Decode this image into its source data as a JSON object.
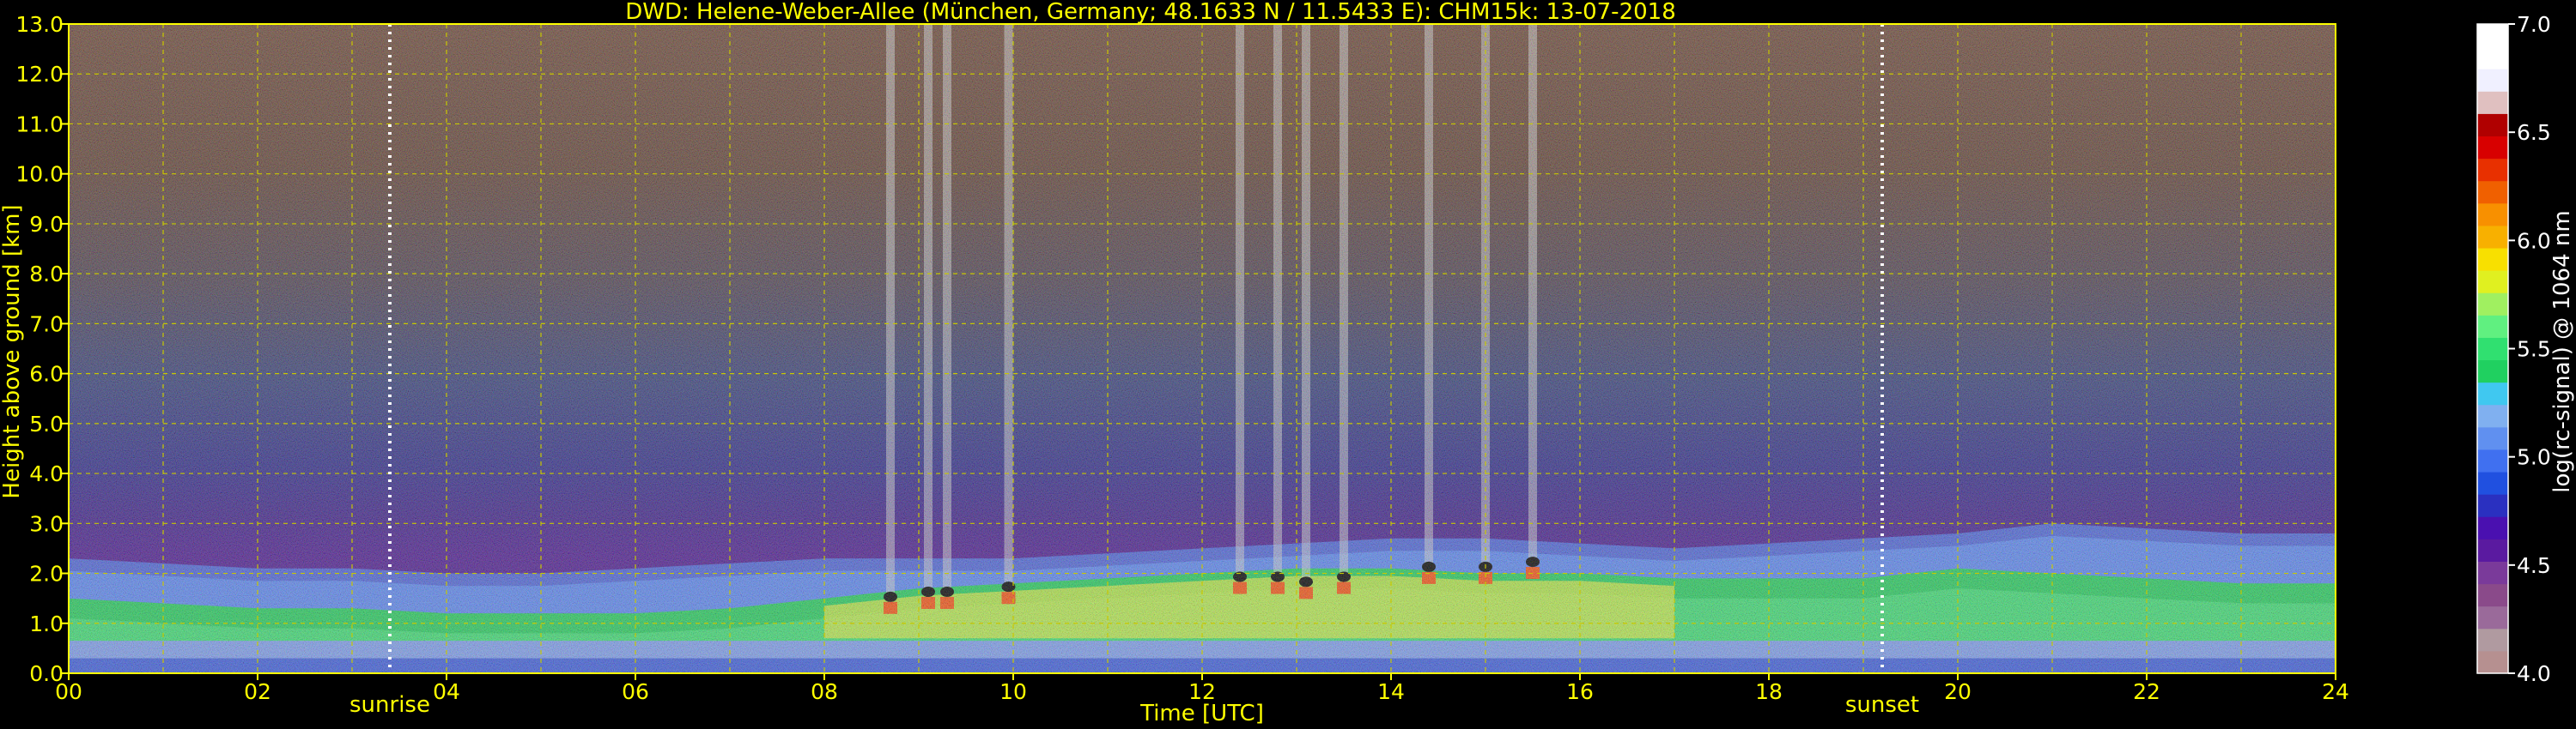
{
  "chart_data": {
    "type": "heatmap",
    "title": "DWD: Helene-Weber-Allee (München, Germany; 48.1633 N / 11.5433 E):    CHM15k: 13-07-2018",
    "xlabel": "Time [UTC]",
    "ylabel": "Height above ground [km]",
    "xlim": [
      0,
      24
    ],
    "ylim": [
      0,
      13
    ],
    "xticks": [
      "00",
      "02",
      "04",
      "06",
      "08",
      "10",
      "12",
      "14",
      "16",
      "18",
      "20",
      "22",
      "24"
    ],
    "yticks": [
      "0.0",
      "1.0",
      "2.0",
      "3.0",
      "4.0",
      "5.0",
      "6.0",
      "7.0",
      "8.0",
      "9.0",
      "10.0",
      "11.0",
      "12.0",
      "13.0"
    ],
    "grid": true,
    "events": [
      {
        "label": "sunrise",
        "time": 3.4
      },
      {
        "label": "sunset",
        "time": 19.2
      }
    ],
    "colorbar": {
      "label": "log(rc-signal) @ 1064 nm",
      "range": [
        4.0,
        7.0
      ],
      "ticks": [
        "4.0",
        "4.5",
        "5.0",
        "5.5",
        "6.0",
        "6.5",
        "7.0"
      ],
      "colors": [
        "#b69090",
        "#b09aa0",
        "#9a6a9a",
        "#8a4a8a",
        "#7a3a9a",
        "#5a1aa0",
        "#4a10b0",
        "#2a30c0",
        "#2050e0",
        "#4070f0",
        "#6090f0",
        "#80b0f0",
        "#40c8f0",
        "#20d060",
        "#30e070",
        "#60f080",
        "#a0f060",
        "#e0f020",
        "#f8e000",
        "#f8b000",
        "#f89000",
        "#f06000",
        "#e83000",
        "#d80000",
        "#b00000",
        "#e0c0c0",
        "#f0f0ff",
        "#ffffff",
        "#ffffff"
      ]
    },
    "boundary_layer_top_km": [
      [
        0,
        2.3
      ],
      [
        1,
        2.2
      ],
      [
        2,
        2.1
      ],
      [
        3,
        2.1
      ],
      [
        4,
        2.0
      ],
      [
        5,
        2.0
      ],
      [
        6,
        2.1
      ],
      [
        7,
        2.2
      ],
      [
        8,
        2.3
      ],
      [
        9,
        2.3
      ],
      [
        10,
        2.3
      ],
      [
        11,
        2.4
      ],
      [
        12,
        2.5
      ],
      [
        13,
        2.6
      ],
      [
        14,
        2.7
      ],
      [
        15,
        2.7
      ],
      [
        16,
        2.6
      ],
      [
        17,
        2.5
      ],
      [
        18,
        2.6
      ],
      [
        19,
        2.7
      ],
      [
        20,
        2.8
      ],
      [
        21,
        3.0
      ],
      [
        22,
        2.9
      ],
      [
        23,
        2.8
      ],
      [
        24,
        2.8
      ]
    ],
    "aerosol_top_km": [
      [
        0,
        1.5
      ],
      [
        1,
        1.4
      ],
      [
        2,
        1.3
      ],
      [
        3,
        1.3
      ],
      [
        4,
        1.2
      ],
      [
        5,
        1.2
      ],
      [
        6,
        1.2
      ],
      [
        7,
        1.3
      ],
      [
        8,
        1.5
      ],
      [
        9,
        1.7
      ],
      [
        10,
        1.8
      ],
      [
        11,
        1.9
      ],
      [
        12,
        2.0
      ],
      [
        13,
        2.1
      ],
      [
        14,
        2.1
      ],
      [
        15,
        2.0
      ],
      [
        16,
        2.0
      ],
      [
        17,
        1.9
      ],
      [
        18,
        1.9
      ],
      [
        19,
        1.9
      ],
      [
        20,
        2.1
      ],
      [
        21,
        2.0
      ],
      [
        22,
        1.9
      ],
      [
        23,
        1.8
      ],
      [
        24,
        1.8
      ]
    ],
    "cloud_events": [
      {
        "time": 8.7,
        "base_km": 1.6
      },
      {
        "time": 9.1,
        "base_km": 1.7
      },
      {
        "time": 9.3,
        "base_km": 1.7
      },
      {
        "time": 9.95,
        "base_km": 1.8
      },
      {
        "time": 12.4,
        "base_km": 2.0
      },
      {
        "time": 12.8,
        "base_km": 2.0
      },
      {
        "time": 13.1,
        "base_km": 1.9
      },
      {
        "time": 13.5,
        "base_km": 2.0
      },
      {
        "time": 14.4,
        "base_km": 2.2
      },
      {
        "time": 15.0,
        "base_km": 2.2
      },
      {
        "time": 15.5,
        "base_km": 2.3
      }
    ]
  }
}
